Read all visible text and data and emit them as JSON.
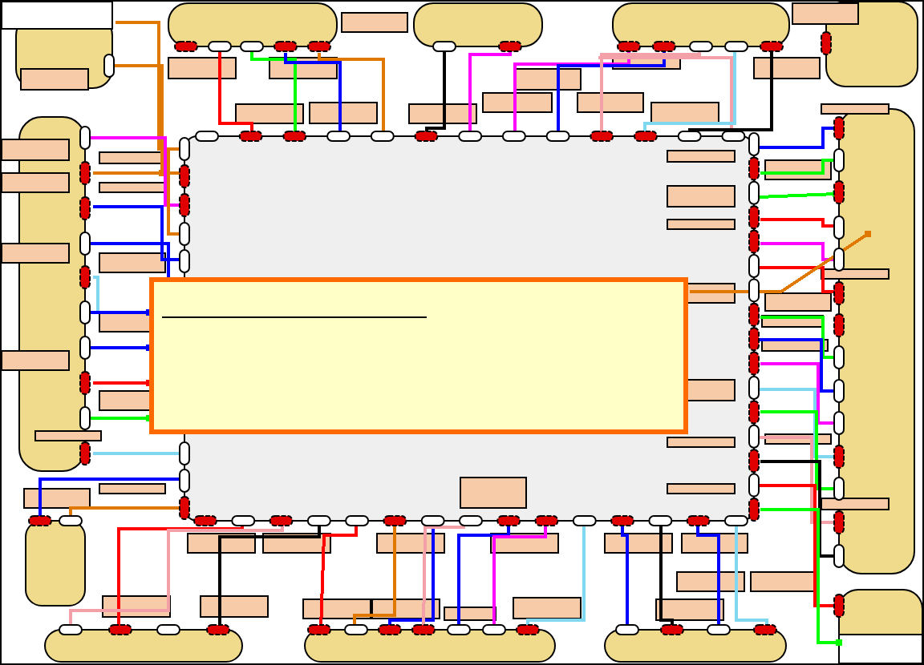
{
  "chip": {
    "top_pins": [
      {
        "connected": false
      },
      {
        "connected": true
      },
      {
        "connected": true
      },
      {
        "connected": false
      },
      {
        "connected": false
      },
      {
        "connected": true
      },
      {
        "connected": false
      },
      {
        "connected": false
      },
      {
        "connected": false
      },
      {
        "connected": true
      },
      {
        "connected": true
      },
      {
        "connected": false
      },
      {
        "connected": false
      }
    ],
    "right_pins": [
      {
        "connected": false
      },
      {
        "connected": true
      },
      {
        "connected": false
      },
      {
        "connected": true
      },
      {
        "connected": true
      },
      {
        "connected": false
      },
      {
        "connected": false
      },
      {
        "connected": true
      },
      {
        "connected": true
      },
      {
        "connected": true
      },
      {
        "connected": false
      },
      {
        "connected": true
      },
      {
        "connected": false
      },
      {
        "connected": true
      },
      {
        "connected": false
      },
      {
        "connected": true
      }
    ],
    "bottom_pins": [
      {
        "connected": true
      },
      {
        "connected": false
      },
      {
        "connected": true
      },
      {
        "connected": false
      },
      {
        "connected": false
      },
      {
        "connected": true
      },
      {
        "connected": false
      },
      {
        "connected": false
      },
      {
        "connected": true
      },
      {
        "connected": true
      },
      {
        "connected": false
      },
      {
        "connected": true
      },
      {
        "connected": false
      },
      {
        "connected": true
      },
      {
        "connected": false
      }
    ],
    "left_pins": [
      {
        "connected": false
      },
      {
        "connected": true
      },
      {
        "connected": true
      },
      {
        "connected": false
      },
      {
        "connected": false
      },
      {
        "connected": false
      },
      {
        "connected": false
      },
      {
        "connected": true
      }
    ]
  },
  "modules": [
    {
      "pins": [
        {
          "connected": false
        }
      ]
    },
    {
      "pins": [
        {
          "connected": true
        },
        {
          "connected": false
        },
        {
          "connected": false
        },
        {
          "connected": true
        },
        {
          "connected": true
        }
      ]
    },
    {
      "pins": [
        {
          "connected": false
        },
        {
          "connected": true
        }
      ]
    },
    {
      "pins": [
        {
          "connected": true
        },
        {
          "connected": true
        },
        {
          "connected": false
        },
        {
          "connected": false
        },
        {
          "connected": true
        }
      ]
    },
    {
      "pins": [
        {
          "connected": true
        }
      ]
    },
    {
      "pins": [
        {
          "connected": false
        },
        {
          "connected": true
        },
        {
          "connected": true
        },
        {
          "connected": false
        },
        {
          "connected": true
        },
        {
          "connected": false
        },
        {
          "connected": false
        },
        {
          "connected": true
        },
        {
          "connected": false
        },
        {
          "connected": true
        }
      ]
    },
    {
      "pins": [
        {
          "connected": true
        },
        {
          "connected": false
        },
        {
          "connected": true
        },
        {
          "connected": false
        },
        {
          "connected": false
        },
        {
          "connected": true
        },
        {
          "connected": true
        },
        {
          "connected": false
        },
        {
          "connected": false
        },
        {
          "connected": false
        },
        {
          "connected": true
        },
        {
          "connected": false
        },
        {
          "connected": true
        },
        {
          "connected": false
        }
      ]
    },
    {
      "pins": [
        {
          "connected": true
        }
      ]
    },
    {
      "pins": [
        {
          "connected": true
        },
        {
          "connected": false
        }
      ]
    },
    {
      "pins": [
        {
          "connected": false
        },
        {
          "connected": true
        },
        {
          "connected": false
        },
        {
          "connected": true
        }
      ]
    },
    {
      "pins": [
        {
          "connected": true
        },
        {
          "connected": false
        },
        {
          "connected": true
        },
        {
          "connected": true
        },
        {
          "connected": false
        },
        {
          "connected": false
        },
        {
          "connected": true
        }
      ]
    },
    {
      "pins": [
        {
          "connected": false
        },
        {
          "connected": true
        },
        {
          "connected": false
        },
        {
          "connected": true
        }
      ]
    }
  ],
  "wires": [
    {
      "color": "#e07800"
    },
    {
      "color": "#e07800"
    },
    {
      "color": "#e07800"
    },
    {
      "color": "#ff00ff"
    },
    {
      "color": "#e07800"
    },
    {
      "color": "#0000ff"
    },
    {
      "color": "#0000ff"
    },
    {
      "color": "#80d8f0"
    },
    {
      "color": "#0000ff"
    },
    {
      "color": "#ff0000"
    },
    {
      "color": "#00ff00"
    },
    {
      "color": "#0000ff"
    },
    {
      "color": "#e07800"
    },
    {
      "color": "#000000"
    },
    {
      "color": "#ff00ff"
    },
    {
      "color": "#ff00ff"
    },
    {
      "color": "#0000ff"
    },
    {
      "color": "#f4a0a8"
    },
    {
      "color": "#f4a0a8"
    },
    {
      "color": "#80d8f0"
    },
    {
      "color": "#000000"
    },
    {
      "color": "#0000ff"
    },
    {
      "color": "#00ff00"
    },
    {
      "color": "#00ff00"
    },
    {
      "color": "#ff0000"
    },
    {
      "color": "#ff00ff"
    },
    {
      "color": "#ff0000"
    },
    {
      "color": "#e07800"
    },
    {
      "color": "#00ff00"
    },
    {
      "color": "#0000ff"
    },
    {
      "color": "#ff00ff"
    },
    {
      "color": "#80d8f0"
    },
    {
      "color": "#00ff00"
    },
    {
      "color": "#f4a0a8"
    },
    {
      "color": "#000000"
    },
    {
      "color": "#ff0000"
    },
    {
      "color": "#00ff00"
    },
    {
      "color": "#0000ff"
    },
    {
      "color": "#ff0000"
    },
    {
      "color": "#00ff00"
    },
    {
      "color": "#80d8f0"
    },
    {
      "color": "#0000ff"
    },
    {
      "color": "#e07800"
    },
    {
      "color": "#ff0000"
    },
    {
      "color": "#f4a0a8"
    },
    {
      "color": "#000000"
    },
    {
      "color": "#ff0000"
    },
    {
      "color": "#e07800"
    },
    {
      "color": "#0000ff"
    },
    {
      "color": "#f4a0a8"
    },
    {
      "color": "#0000ff"
    },
    {
      "color": "#ff00ff"
    },
    {
      "color": "#80d8f0"
    },
    {
      "color": "#0000ff"
    },
    {
      "color": "#000000"
    },
    {
      "color": "#0000ff"
    },
    {
      "color": "#80d8f0"
    }
  ]
}
